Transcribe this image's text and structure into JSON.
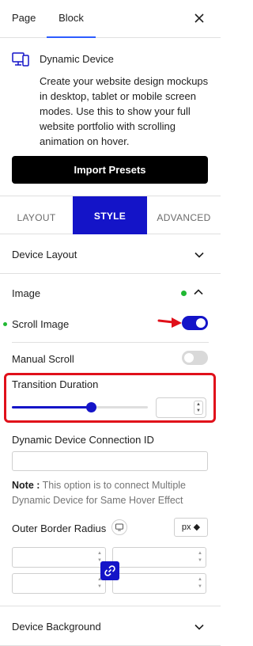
{
  "top_tabs": {
    "page": "Page",
    "block": "Block"
  },
  "block_info": {
    "title": "Dynamic Device",
    "description": "Create your website design mockups in desktop, tablet or mobile screen modes. Use this to show your full website portfolio with scrolling animation on hover.",
    "import_button": "Import Presets"
  },
  "style_tabs": {
    "layout": "LAYOUT",
    "style": "STYLE",
    "advanced": "ADVANCED",
    "active": "STYLE"
  },
  "sections": {
    "device_layout": "Device Layout",
    "image": "Image",
    "device_background": "Device Background"
  },
  "image_panel": {
    "scroll_image_label": "Scroll Image",
    "scroll_image_enabled": true,
    "manual_scroll_label": "Manual Scroll",
    "manual_scroll_enabled": false,
    "transition_duration_label": "Transition Duration",
    "transition_duration_value": "",
    "transition_slider_fraction": 0.59,
    "connection_id_label": "Dynamic Device Connection ID",
    "connection_id_value": "",
    "note_prefix": "Note :",
    "note_text": " This option is to connect Multiple Dynamic Device for Same Hover Effect",
    "outer_border_radius_label": "Outer Border Radius",
    "unit": "px"
  },
  "colors": {
    "accent": "#1414c8",
    "active_dot": "#20b833",
    "highlight": "#e0101a",
    "tab_underline": "#2c5cff"
  },
  "icons": [
    "close-icon",
    "device-icon",
    "chevron-down-icon",
    "chevron-up-icon",
    "arrow-icon",
    "monitor-icon",
    "link-icon"
  ]
}
